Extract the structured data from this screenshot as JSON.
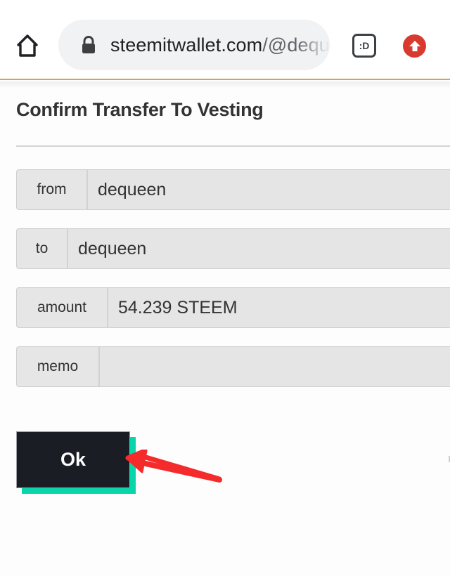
{
  "browser": {
    "url_host": "steemitwallet.com",
    "url_path": "/@dequeen",
    "icons": {
      "home": "home-icon",
      "lock": "lock-icon",
      "extension": "emoji-extension-icon",
      "extension_text": ":D",
      "update": "update-arrow-icon"
    },
    "accent_color": "#d2a35c"
  },
  "dialog": {
    "title": "Confirm Transfer To Vesting",
    "fields": [
      {
        "label": "from",
        "value": "dequeen"
      },
      {
        "label": "to",
        "value": "dequeen"
      },
      {
        "label": "amount",
        "value": "54.239 STEEM"
      },
      {
        "label": "memo",
        "value": ""
      }
    ],
    "ok_label": "Ok",
    "ok_button_color": "#1a1e24",
    "ok_shadow_color": "#06d6a9"
  },
  "annotation": {
    "type": "red-arrow",
    "points_to": "ok-button",
    "color": "#f52a2a"
  }
}
